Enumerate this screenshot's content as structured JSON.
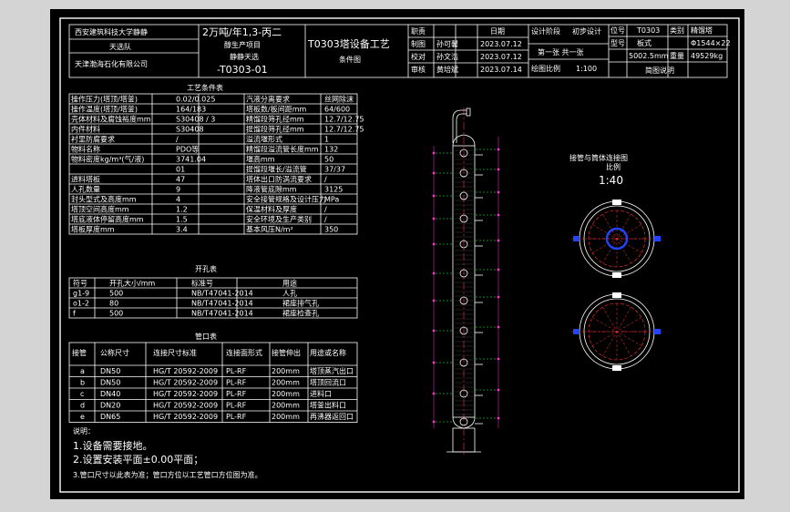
{
  "colors": {
    "background": "#000000",
    "border": "#ffffff",
    "frame_gray": "#d4d4d4",
    "center_line": "#ff3333",
    "nozzle_blue": "#2244ff",
    "dim_green": "#33ff33",
    "marker_pink": "#ff33cc"
  },
  "title_block": {
    "org": "西安建筑科技大学静静",
    "team": "天选队",
    "company": "天津渤海石化有限公司",
    "project_line1": "2万吨/年1,3-丙二",
    "project_line2": "醇生产项目",
    "project_line3": "静静天选",
    "project_line4": "-T0303-01",
    "drawing_title_1": "T0303塔设备工艺",
    "drawing_title_2": "条件图",
    "roles": [
      "职责",
      "制图",
      "校对",
      "审核"
    ],
    "names": [
      "",
      "孙可馨",
      "孙文浩",
      "黄培斌"
    ],
    "date_header": "日期",
    "dates": [
      "",
      "2023.07.12",
      "2023.07.12",
      "2023.07.14"
    ],
    "stage_label": "设计阶段",
    "stage_value": "初步设计",
    "sheet_text": "第一张 共一张",
    "scale_label": "绘图比例",
    "scale_value": "1:100",
    "tag_label": "位号",
    "tag_value": "T0303",
    "category_label": "类别",
    "category_value": "精馏塔",
    "model_label": "型号",
    "model_value": "板式",
    "weight_label": "重量",
    "weight_value": "49529kg",
    "spec_value": "Φ1544×22",
    "size_value": "5002.5mm",
    "ref_label": "简图说明"
  },
  "process_table": {
    "title": "工艺条件表",
    "rows": [
      [
        "操作压力(塔顶/塔釜)",
        "0.02/0.025",
        "汽液分离要求",
        "丝网除沫"
      ],
      [
        "操作温度(塔顶/塔釜)",
        "164/183",
        "塔板数/板间距mm",
        "64/600"
      ],
      [
        "壳体材料及腐蚀裕度mm",
        "S30408 / 3",
        "精馏段筛孔径mm",
        "12.7/12.75"
      ],
      [
        "内件材料",
        "S30408",
        "提馏段筛孔径mm",
        "12.7/12.75"
      ],
      [
        "衬里防腐要求",
        "/",
        "溢流堰形式",
        "1"
      ],
      [
        "物料名称",
        "PDO等",
        "精馏段溢流管长度mm",
        "132"
      ],
      [
        "物料密度kg/m³(气/液)",
        "3741.04",
        "堰高mm",
        "50"
      ],
      [
        "",
        "01",
        "提馏段堰长/溢流管",
        "37/37"
      ],
      [
        "进料塔板",
        "47",
        "塔体出口防涡流要求",
        "/"
      ],
      [
        "人孔数量",
        "9",
        "降液管底隙mm",
        "3125"
      ],
      [
        "封头型式及高度mm",
        "4",
        "安全接管规格及设计压力",
        "MPa"
      ],
      [
        "塔顶空间高度mm",
        "1.2",
        "保温材料及厚度",
        "/"
      ],
      [
        "塔底液体停留高度mm",
        "1.5",
        "安全环境及生产类别",
        "/"
      ],
      [
        "塔板厚度mm",
        "3.4",
        "基本风压N/m²",
        "350"
      ]
    ]
  },
  "hole_table": {
    "title": "开孔表",
    "headers": [
      "符号",
      "开孔大小/mm",
      "标准号",
      "用途"
    ],
    "rows": [
      [
        "g1-9",
        "500",
        "NB/T47041-2014",
        "人孔"
      ],
      [
        "o1-2",
        "80",
        "NB/T47041-2014",
        "裙座排气孔"
      ],
      [
        "f",
        "500",
        "NB/T47041-2014",
        "裙座检查孔"
      ]
    ]
  },
  "nozzle_table": {
    "title": "管口表",
    "headers": [
      "接管",
      "公称尺寸",
      "连接尺寸标准",
      "连接面形式",
      "接管伸出",
      "用途或名称"
    ],
    "rows": [
      [
        "a",
        "DN50",
        "HG/T 20592-2009",
        "PL-RF",
        "200mm",
        "塔顶蒸汽出口"
      ],
      [
        "b",
        "DN50",
        "HG/T 20592-2009",
        "PL-RF",
        "200mm",
        "塔顶回流口"
      ],
      [
        "c",
        "DN40",
        "HG/T 20592-2009",
        "PL-RF",
        "200mm",
        "进料口"
      ],
      [
        "d",
        "DN20",
        "HG/T 20592-2009",
        "PL-RF",
        "200mm",
        "塔釜出料口"
      ],
      [
        "e",
        "DN65",
        "HG/T 20592-2009",
        "PL-RF",
        "200mm",
        "再沸器返回口"
      ]
    ]
  },
  "notes": {
    "title": "说明：",
    "items": [
      "1.设备需要接地。",
      "2.设置安装平面±0.00平面；",
      "3.管口尺寸以此表为准；管口方位以工艺管口方位图为准。"
    ]
  },
  "orientation": {
    "title": "接管与筒体连接图",
    "scale_label": "比例",
    "scale_value": "1:40"
  }
}
